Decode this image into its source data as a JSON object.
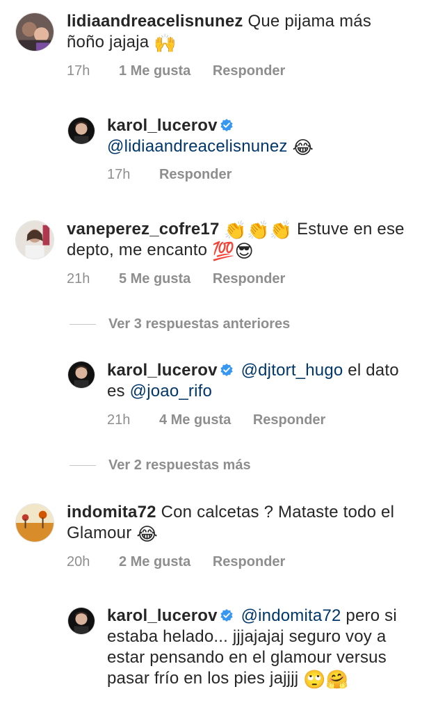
{
  "comments": [
    {
      "username": "lidiaandreacelisnunez",
      "text": "Que pijama más ñoño jajaja",
      "emoji": "🙌",
      "time": "17h",
      "likes": "1 Me gusta",
      "reply": "Responder"
    },
    {
      "username": "karol_lucerov",
      "mention": "@lidiaandreacelisnunez",
      "emoji": "😂",
      "time": "17h",
      "reply": "Responder"
    },
    {
      "username": "vaneperez_cofre17",
      "emoji_prefix": "👏👏👏",
      "text": "Estuve en ese depto, me encanto",
      "emoji": "💯😎",
      "time": "21h",
      "likes": "5 Me gusta",
      "reply": "Responder"
    },
    {
      "view_more": "Ver 3 respuestas anteriores"
    },
    {
      "username": "karol_lucerov",
      "mention1": "@djtort_hugo",
      "text1": "el dato es",
      "mention2": "@joao_rifo",
      "time": "21h",
      "likes": "4 Me gusta",
      "reply": "Responder"
    },
    {
      "view_more": "Ver 2 respuestas más"
    },
    {
      "username": "indomita72",
      "text": "Con calcetas ? Mataste todo el Glamour",
      "emoji": "😂",
      "time": "20h",
      "likes": "2 Me gusta",
      "reply": "Responder"
    },
    {
      "username": "karol_lucerov",
      "mention": "@indomita72",
      "text": "pero si estaba helado... jjjajajaj seguro voy a estar pensando en el glamour versus pasar frío en los pies jajjjj",
      "emoji": "🙄🤗"
    }
  ],
  "icons": {
    "verified": "verified-badge-icon",
    "verified_color": "#3897f0"
  }
}
